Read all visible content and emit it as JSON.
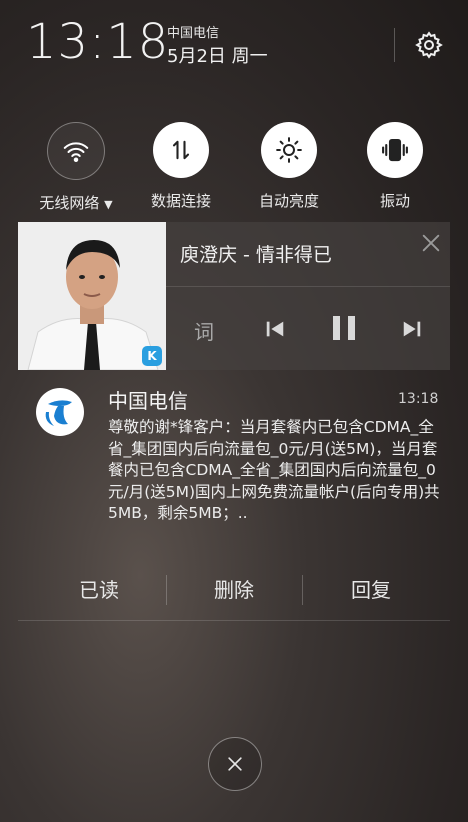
{
  "status": {
    "time": "13:18",
    "carrier": "中国电信",
    "date": "5月2日 周一"
  },
  "quick_toggles": [
    {
      "label": "无线网络",
      "icon": "wifi-icon",
      "state": "off",
      "has_dropdown": true
    },
    {
      "label": "数据连接",
      "icon": "data-transfer-icon",
      "state": "on"
    },
    {
      "label": "自动亮度",
      "icon": "brightness-icon",
      "state": "on"
    },
    {
      "label": "振动",
      "icon": "vibrate-icon",
      "state": "on"
    }
  ],
  "music": {
    "title": "庾澄庆 - 情非得已",
    "lyrics_label": "词",
    "app_badge": "K",
    "state": "paused"
  },
  "notification": {
    "app": "中国电信",
    "time": "13:18",
    "body": "尊敬的谢*锋客户：当月套餐内已包含CDMA_全省_集团国内后向流量包_0元/月(送5M)，当月套餐内已包含CDMA_全省_集团国内后向流量包_0元/月(送5M)国内上网免费流量帐户(后向专用)共5MB，剩余5MB；..",
    "actions": [
      "已读",
      "删除",
      "回复"
    ]
  },
  "colors": {
    "accent_blue": "#1a7fd1",
    "music_badge": "#2a9fe0"
  }
}
